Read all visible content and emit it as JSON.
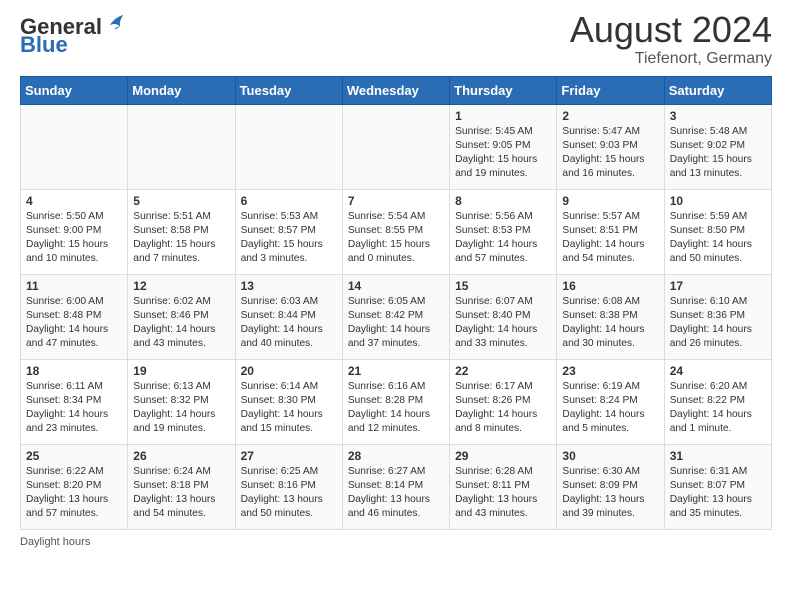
{
  "header": {
    "logo_general": "General",
    "logo_blue": "Blue",
    "month_year": "August 2024",
    "location": "Tiefenort, Germany"
  },
  "days_of_week": [
    "Sunday",
    "Monday",
    "Tuesday",
    "Wednesday",
    "Thursday",
    "Friday",
    "Saturday"
  ],
  "weeks": [
    [
      {
        "day": "",
        "info": ""
      },
      {
        "day": "",
        "info": ""
      },
      {
        "day": "",
        "info": ""
      },
      {
        "day": "",
        "info": ""
      },
      {
        "day": "1",
        "info": "Sunrise: 5:45 AM\nSunset: 9:05 PM\nDaylight: 15 hours\nand 19 minutes."
      },
      {
        "day": "2",
        "info": "Sunrise: 5:47 AM\nSunset: 9:03 PM\nDaylight: 15 hours\nand 16 minutes."
      },
      {
        "day": "3",
        "info": "Sunrise: 5:48 AM\nSunset: 9:02 PM\nDaylight: 15 hours\nand 13 minutes."
      }
    ],
    [
      {
        "day": "4",
        "info": "Sunrise: 5:50 AM\nSunset: 9:00 PM\nDaylight: 15 hours\nand 10 minutes."
      },
      {
        "day": "5",
        "info": "Sunrise: 5:51 AM\nSunset: 8:58 PM\nDaylight: 15 hours\nand 7 minutes."
      },
      {
        "day": "6",
        "info": "Sunrise: 5:53 AM\nSunset: 8:57 PM\nDaylight: 15 hours\nand 3 minutes."
      },
      {
        "day": "7",
        "info": "Sunrise: 5:54 AM\nSunset: 8:55 PM\nDaylight: 15 hours\nand 0 minutes."
      },
      {
        "day": "8",
        "info": "Sunrise: 5:56 AM\nSunset: 8:53 PM\nDaylight: 14 hours\nand 57 minutes."
      },
      {
        "day": "9",
        "info": "Sunrise: 5:57 AM\nSunset: 8:51 PM\nDaylight: 14 hours\nand 54 minutes."
      },
      {
        "day": "10",
        "info": "Sunrise: 5:59 AM\nSunset: 8:50 PM\nDaylight: 14 hours\nand 50 minutes."
      }
    ],
    [
      {
        "day": "11",
        "info": "Sunrise: 6:00 AM\nSunset: 8:48 PM\nDaylight: 14 hours\nand 47 minutes."
      },
      {
        "day": "12",
        "info": "Sunrise: 6:02 AM\nSunset: 8:46 PM\nDaylight: 14 hours\nand 43 minutes."
      },
      {
        "day": "13",
        "info": "Sunrise: 6:03 AM\nSunset: 8:44 PM\nDaylight: 14 hours\nand 40 minutes."
      },
      {
        "day": "14",
        "info": "Sunrise: 6:05 AM\nSunset: 8:42 PM\nDaylight: 14 hours\nand 37 minutes."
      },
      {
        "day": "15",
        "info": "Sunrise: 6:07 AM\nSunset: 8:40 PM\nDaylight: 14 hours\nand 33 minutes."
      },
      {
        "day": "16",
        "info": "Sunrise: 6:08 AM\nSunset: 8:38 PM\nDaylight: 14 hours\nand 30 minutes."
      },
      {
        "day": "17",
        "info": "Sunrise: 6:10 AM\nSunset: 8:36 PM\nDaylight: 14 hours\nand 26 minutes."
      }
    ],
    [
      {
        "day": "18",
        "info": "Sunrise: 6:11 AM\nSunset: 8:34 PM\nDaylight: 14 hours\nand 23 minutes."
      },
      {
        "day": "19",
        "info": "Sunrise: 6:13 AM\nSunset: 8:32 PM\nDaylight: 14 hours\nand 19 minutes."
      },
      {
        "day": "20",
        "info": "Sunrise: 6:14 AM\nSunset: 8:30 PM\nDaylight: 14 hours\nand 15 minutes."
      },
      {
        "day": "21",
        "info": "Sunrise: 6:16 AM\nSunset: 8:28 PM\nDaylight: 14 hours\nand 12 minutes."
      },
      {
        "day": "22",
        "info": "Sunrise: 6:17 AM\nSunset: 8:26 PM\nDaylight: 14 hours\nand 8 minutes."
      },
      {
        "day": "23",
        "info": "Sunrise: 6:19 AM\nSunset: 8:24 PM\nDaylight: 14 hours\nand 5 minutes."
      },
      {
        "day": "24",
        "info": "Sunrise: 6:20 AM\nSunset: 8:22 PM\nDaylight: 14 hours\nand 1 minute."
      }
    ],
    [
      {
        "day": "25",
        "info": "Sunrise: 6:22 AM\nSunset: 8:20 PM\nDaylight: 13 hours\nand 57 minutes."
      },
      {
        "day": "26",
        "info": "Sunrise: 6:24 AM\nSunset: 8:18 PM\nDaylight: 13 hours\nand 54 minutes."
      },
      {
        "day": "27",
        "info": "Sunrise: 6:25 AM\nSunset: 8:16 PM\nDaylight: 13 hours\nand 50 minutes."
      },
      {
        "day": "28",
        "info": "Sunrise: 6:27 AM\nSunset: 8:14 PM\nDaylight: 13 hours\nand 46 minutes."
      },
      {
        "day": "29",
        "info": "Sunrise: 6:28 AM\nSunset: 8:11 PM\nDaylight: 13 hours\nand 43 minutes."
      },
      {
        "day": "30",
        "info": "Sunrise: 6:30 AM\nSunset: 8:09 PM\nDaylight: 13 hours\nand 39 minutes."
      },
      {
        "day": "31",
        "info": "Sunrise: 6:31 AM\nSunset: 8:07 PM\nDaylight: 13 hours\nand 35 minutes."
      }
    ]
  ],
  "footer": {
    "note": "Daylight hours"
  }
}
